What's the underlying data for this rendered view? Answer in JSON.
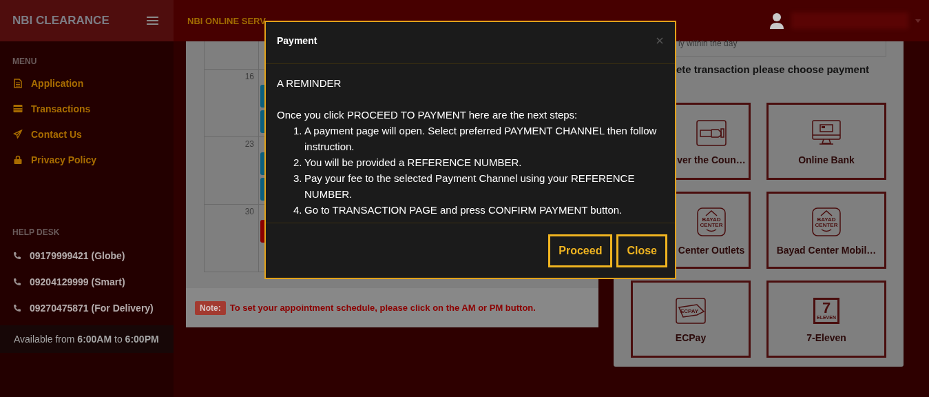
{
  "sidebar": {
    "brand": "NBI CLEARANCE",
    "menu_heading": "MENU",
    "menu": [
      {
        "label": "Application",
        "kind": "document"
      },
      {
        "label": "Transactions",
        "kind": "card"
      },
      {
        "label": "Contact Us",
        "kind": "plane"
      },
      {
        "label": "Privacy Policy",
        "kind": "lock"
      }
    ],
    "helpdesk_heading": "HELP DESK",
    "phones": [
      "09179999421 (Globe)",
      "09204129999 (Smart)",
      "09270475871 (For Delivery)"
    ],
    "availability": "Available from **6:00AM** to **6:00PM**"
  },
  "topbar": {
    "title": "NBI ONLINE SERV"
  },
  "calendar": {
    "weeks": [
      {
        "date": "16",
        "events": [
          {
            "color": "#0b5f7e"
          },
          {
            "color": "#0b5f7e"
          }
        ]
      },
      {
        "date": "23",
        "events": [
          {
            "color": "#0b5f7e"
          },
          {
            "color": "#0b5f7e"
          }
        ]
      },
      {
        "date": "30",
        "events": [
          {
            "color": "#8a0000"
          }
        ]
      }
    ]
  },
  "note": {
    "label": "Note:",
    "text": "To set your appointment schedule, please click on the AM or PM button."
  },
  "payment_panel": {
    "notice": "ly within the day",
    "heading": "ete transaction please choose payment",
    "options": [
      {
        "label": "ver the Coun…",
        "kind": "counter"
      },
      {
        "label": "Online Bank",
        "kind": "monitor"
      },
      {
        "label": "Center Outlets",
        "kind": "bayad",
        "logo_text": [
          "BAYAD",
          "CENTER"
        ]
      },
      {
        "label": "Bayad Center Mobil…",
        "kind": "bayad",
        "logo_text": [
          "BAYAD",
          "CENTER"
        ]
      },
      {
        "label": "ECPay",
        "kind": "ecpay",
        "logo_text": [
          "ECPAY"
        ]
      },
      {
        "label": "7-Eleven",
        "kind": "seven",
        "logo_text": [
          "7",
          "ELEVEN"
        ]
      }
    ]
  },
  "modal": {
    "title": "Payment",
    "heading": "A REMINDER",
    "intro": "Once you click PROCEED TO PAYMENT here are the next steps:",
    "steps": [
      {
        "number": "1.",
        "text": "A payment page will open. Select preferred PAYMENT CHANNEL then follow instruction."
      },
      {
        "number": "2.",
        "text": "You will be provided a REFERENCE NUMBER."
      },
      {
        "number": "3.",
        "text": "Pay your fee to the selected Payment Channel using your REFERENCE NUMBER."
      },
      {
        "number": "4.",
        "text": "Go to TRANSACTION PAGE and press CONFIRM PAYMENT button."
      }
    ],
    "buttons": [
      "Proceed",
      "Close"
    ]
  }
}
